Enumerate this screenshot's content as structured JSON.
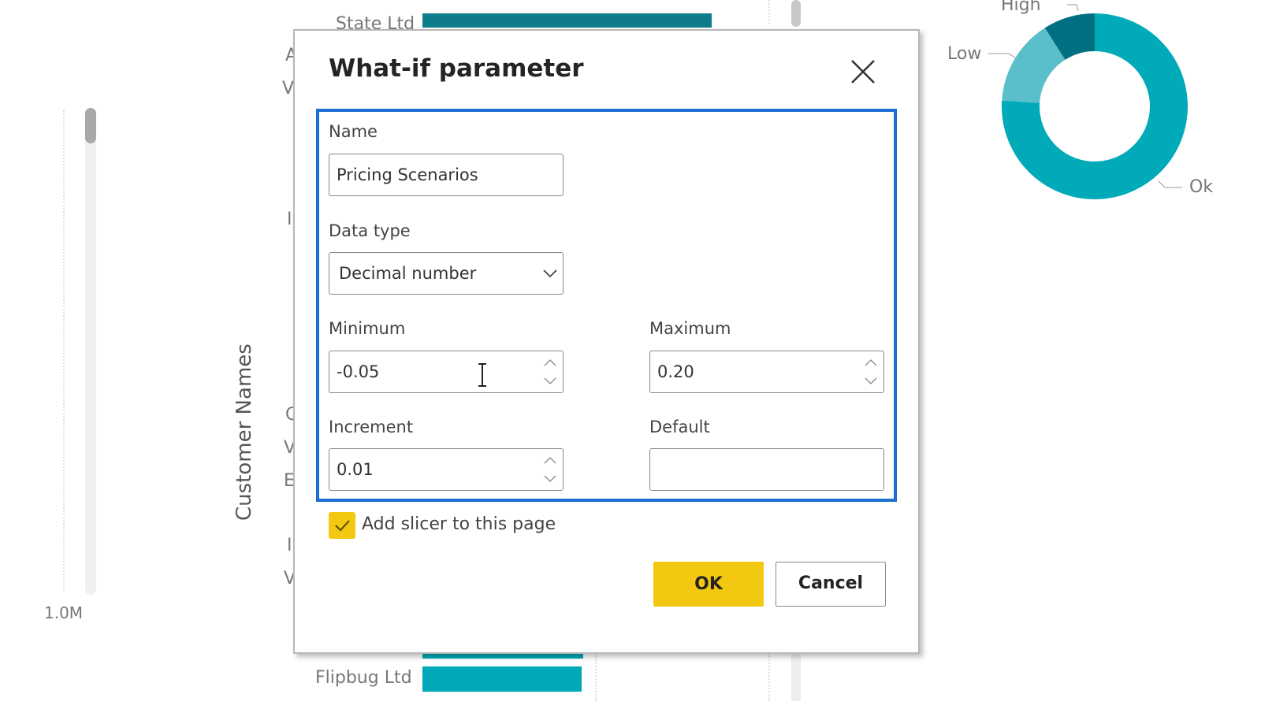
{
  "background": {
    "bar_chart": {
      "axis_title": "Customer Names",
      "axis_tick": "1.0M",
      "bars": [
        {
          "label": "State Ltd",
          "color": "#0e7c8a"
        },
        {
          "label": "",
          "color": "#00a9b7"
        },
        {
          "label": "Flipbug Ltd",
          "color": "#00a9b7"
        }
      ],
      "partial_labels": [
        "A",
        "V",
        "I",
        "C",
        "V",
        "E",
        "I",
        "V"
      ]
    },
    "donut_chart": {
      "slices": [
        {
          "label": "Ok",
          "share": 0.76,
          "color": "#00aab8"
        },
        {
          "label": "Low",
          "share": 0.15,
          "color": "#5abfca"
        },
        {
          "label": "High",
          "share": 0.09,
          "color": "#006f82"
        }
      ]
    }
  },
  "dialog": {
    "title": "What-if parameter",
    "close_icon": "close-icon",
    "name_label": "Name",
    "name_value": "Pricing Scenarios",
    "data_type_label": "Data type",
    "data_type_value": "Decimal number",
    "minimum_label": "Minimum",
    "minimum_value": "-0.05",
    "maximum_label": "Maximum",
    "maximum_value": "0.20",
    "increment_label": "Increment",
    "increment_value": "0.01",
    "default_label": "Default",
    "default_value": "",
    "add_slicer_label": "Add slicer to this page",
    "add_slicer_checked": true,
    "ok_label": "OK",
    "cancel_label": "Cancel",
    "accent_color": "#f2c811",
    "highlight_color": "#1a6fd1"
  }
}
